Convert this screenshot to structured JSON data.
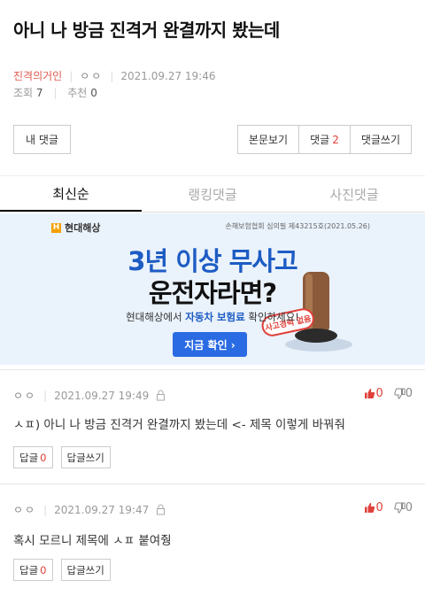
{
  "post": {
    "title": "아니 나 방금 진격거 완결까지 봤는데",
    "author": "진격의거인",
    "nickname": "ㅇㅇ",
    "datetime": "2021.09.27 19:46",
    "views_label": "조회",
    "views": "7",
    "likes_label": "추천",
    "likes": "0"
  },
  "buttons": {
    "my_comments": "내 댓글",
    "view_post": "본문보기",
    "comments_label": "댓글",
    "comments_count": "2",
    "write_comment": "댓글쓰기"
  },
  "tabs": [
    "최신순",
    "랭킹댓글",
    "사진댓글"
  ],
  "ad": {
    "logo_mark": "H",
    "logo": "현대해상",
    "notice": "손해보험협회 심의필 제43215호(2021.05.26)",
    "headline1": "3년 이상 무사고",
    "headline2": "운전자라면?",
    "sub_pre": "현대해상에서 ",
    "sub_highlight": "자동차 보험료",
    "sub_post": " 확인하세요!",
    "cta": "지금 확인 ›",
    "badge": "사고경력 없음"
  },
  "comments": [
    {
      "nickname": "ㅇㅇ",
      "datetime": "2021.09.27 19:49",
      "likes": "0",
      "dislikes": "0",
      "text": "ㅅㅍ) 아니 나 방금 진격거 완결까지 봤는데 <- 제목 이렇게 바꿔줘",
      "reply_label": "답글",
      "reply_count": "0",
      "write_reply": "답글쓰기"
    },
    {
      "nickname": "ㅇㅇ",
      "datetime": "2021.09.27 19:47",
      "likes": "0",
      "dislikes": "0",
      "text": "혹시 모르니 제목에 ㅅㅍ 붙여줭",
      "reply_label": "답글",
      "reply_count": "0",
      "write_reply": "답글쓰기"
    }
  ],
  "colors": {
    "accent_red": "#e0403a",
    "author_red": "#e05a4e",
    "ad_blue": "#1d5cc4",
    "cta_blue": "#2a6be3"
  }
}
